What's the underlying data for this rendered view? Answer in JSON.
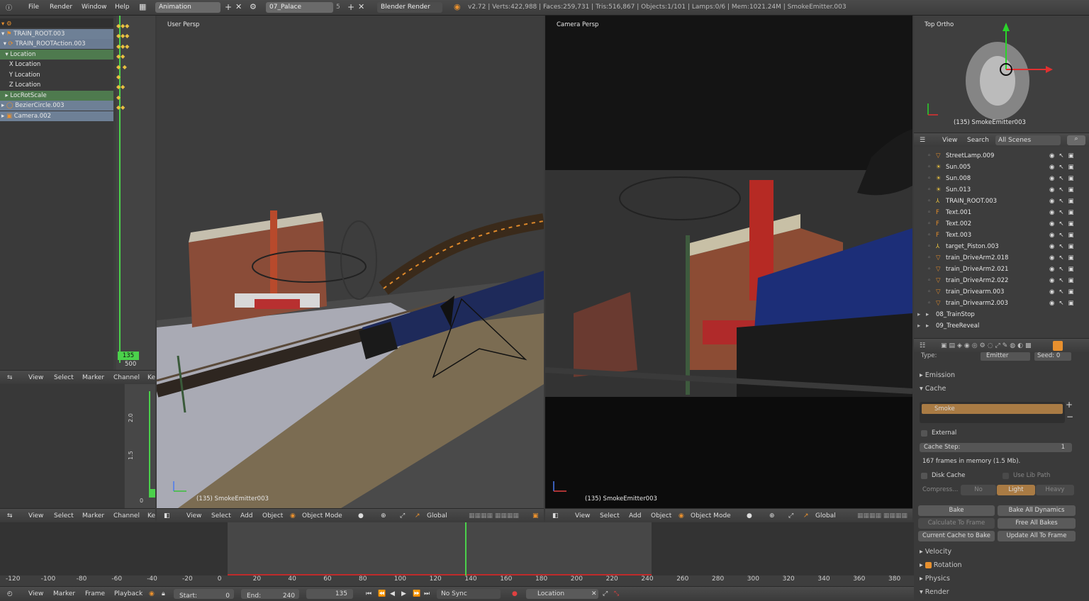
{
  "topbar": {
    "menus": [
      "File",
      "Render",
      "Window",
      "Help"
    ],
    "layout_name": "Animation",
    "scene_name": "07_Palace",
    "scene_users": "5",
    "engine": "Blender Render",
    "stats": "v2.72 | Verts:422,988 | Faces:259,731 | Tris:516,867 | Objects:1/101 | Lamps:0/6 | Mem:1021.24M | SmokeEmitter.003"
  },
  "dopesheet": {
    "items": [
      {
        "label": "TRAIN_ROOT.003"
      },
      {
        "label": "TRAIN_ROOTAction.003"
      },
      {
        "label": "Location"
      },
      {
        "label": "X Location"
      },
      {
        "label": "Y Location"
      },
      {
        "label": "Z Location"
      },
      {
        "label": "LocRotScale"
      },
      {
        "label": "BezierCircle.003"
      },
      {
        "label": "Camera.002"
      }
    ],
    "current_frame": "135",
    "end_frame": "500",
    "header": [
      "View",
      "Select",
      "Marker",
      "Channel",
      "Ke"
    ]
  },
  "graph": {
    "ticks": [
      "2.0",
      "1.5",
      "0"
    ],
    "header": [
      "View",
      "Select",
      "Marker",
      "Channel",
      "Ke"
    ]
  },
  "viewport_left": {
    "label": "User Persp",
    "object_label": "(135) SmokeEmitter003",
    "header": [
      "View",
      "Select",
      "Add",
      "Object"
    ],
    "mode": "Object Mode",
    "orientation": "Global"
  },
  "viewport_right": {
    "label": "Camera Persp",
    "object_label": "(135) SmokeEmitter003",
    "header": [
      "View",
      "Select",
      "Add",
      "Object"
    ],
    "mode": "Object Mode",
    "orientation": "Global"
  },
  "viewport_top": {
    "label": "Top Ortho",
    "object_label": "(135) SmokeEmitter003"
  },
  "outliner": {
    "header": [
      "View",
      "Search"
    ],
    "scene_filter": "All Scenes",
    "items": [
      {
        "label": "StreetLamp.009",
        "type": "mesh"
      },
      {
        "label": "Sun.005",
        "type": "lamp"
      },
      {
        "label": "Sun.008",
        "type": "lamp"
      },
      {
        "label": "Sun.013",
        "type": "lamp"
      },
      {
        "label": "TRAIN_ROOT.003",
        "type": "empty"
      },
      {
        "label": "Text.001",
        "type": "text"
      },
      {
        "label": "Text.002",
        "type": "text"
      },
      {
        "label": "Text.003",
        "type": "text"
      },
      {
        "label": "target_Piston.003",
        "type": "empty"
      },
      {
        "label": "train_DriveArm2.018",
        "type": "mesh"
      },
      {
        "label": "train_DriveArm2.021",
        "type": "mesh"
      },
      {
        "label": "train_DriveArm2.022",
        "type": "mesh"
      },
      {
        "label": "train_Drivearm.003",
        "type": "mesh"
      },
      {
        "label": "train_Drivearm2.003",
        "type": "mesh"
      },
      {
        "label": "08_TrainStop",
        "type": "scene"
      },
      {
        "label": "09_TreeReveal",
        "type": "scene"
      }
    ]
  },
  "properties": {
    "type_label": "Type:",
    "type_value": "Emitter",
    "seed_label": "Seed:",
    "seed_value": "0",
    "sections": {
      "emission": "Emission",
      "cache": "Cache",
      "velocity": "Velocity",
      "rotation": "Rotation",
      "physics": "Physics",
      "render": "Render"
    },
    "cache_item": "Smoke",
    "external": "External",
    "cache_step_label": "Cache Step:",
    "cache_step_value": "1",
    "memory_info": "167 frames in memory (1.5 Mb).",
    "disk_cache": "Disk Cache",
    "use_lib_path": "Use Lib Path",
    "compress_label": "Compress...",
    "compress_options": [
      "No",
      "Light",
      "Heavy"
    ],
    "compress_selected": "Light",
    "buttons": {
      "bake": "Bake",
      "bake_all": "Bake All Dynamics",
      "calc_frame": "Calculate To Frame",
      "free_all": "Free All Bakes",
      "current_cache": "Current Cache to Bake",
      "update_all": "Update All To Frame"
    }
  },
  "timeline": {
    "ruler": [
      "-120",
      "-100",
      "-80",
      "-60",
      "-40",
      "-20",
      "0",
      "20",
      "40",
      "60",
      "80",
      "100",
      "120",
      "140",
      "160",
      "180",
      "200",
      "220",
      "240",
      "260",
      "280",
      "300",
      "320",
      "340",
      "360",
      "380"
    ],
    "header": [
      "View",
      "Marker",
      "Frame",
      "Playback"
    ],
    "start_label": "Start:",
    "start_value": "0",
    "end_label": "End:",
    "end_value": "240",
    "current": "135",
    "sync": "No Sync",
    "keying_set": "Location"
  },
  "colors": {
    "accent": "#e8902e",
    "playhead": "#4bd14b",
    "selection": "#7a8fa8"
  }
}
